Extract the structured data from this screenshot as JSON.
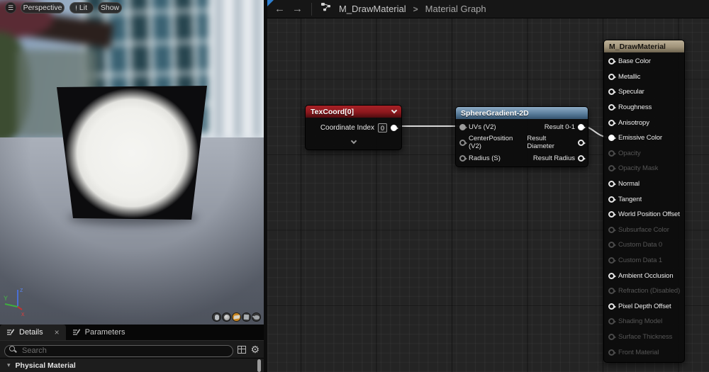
{
  "viewport_toolbar": {
    "menu_icon": "hamburger-menu",
    "perspective_label": "Perspective",
    "lit_label": "Lit",
    "show_label": "Show"
  },
  "viewport": {
    "axis_gizmo": {
      "x_label": "x",
      "y_label": "Y",
      "z_label": "z"
    },
    "preview_shapes": [
      "cylinder",
      "sphere",
      "plane",
      "cube",
      "teapot"
    ],
    "selected_shape": "plane"
  },
  "graph_header": {
    "back_icon": "←",
    "forward_icon": "→",
    "material_name": "M_DrawMaterial",
    "separator": ">",
    "graph_name": "Material Graph"
  },
  "nodes": {
    "texcoord": {
      "title": "TexCoord[0]",
      "row_label": "Coordinate Index",
      "row_value": "0"
    },
    "sphere_gradient": {
      "title": "SphereGradient-2D",
      "inputs": [
        {
          "label": "UVs (V2)",
          "connected": true
        },
        {
          "label": "CenterPosition (V2)",
          "connected": false
        },
        {
          "label": "Radius (S)",
          "connected": false
        }
      ],
      "outputs": [
        {
          "label": "Result 0-1",
          "connected": true
        },
        {
          "label": "Result Diameter",
          "connected": false
        },
        {
          "label": "Result Radius",
          "connected": false
        }
      ]
    },
    "result": {
      "title": "M_DrawMaterial",
      "pins": [
        {
          "label": "Base Color",
          "enabled": true,
          "connected": false
        },
        {
          "label": "Metallic",
          "enabled": true,
          "connected": false
        },
        {
          "label": "Specular",
          "enabled": true,
          "connected": false
        },
        {
          "label": "Roughness",
          "enabled": true,
          "connected": false
        },
        {
          "label": "Anisotropy",
          "enabled": true,
          "connected": false
        },
        {
          "label": "Emissive Color",
          "enabled": true,
          "connected": true
        },
        {
          "label": "Opacity",
          "enabled": false,
          "connected": false
        },
        {
          "label": "Opacity Mask",
          "enabled": false,
          "connected": false
        },
        {
          "label": "Normal",
          "enabled": true,
          "connected": false
        },
        {
          "label": "Tangent",
          "enabled": true,
          "connected": false
        },
        {
          "label": "World Position Offset",
          "enabled": true,
          "connected": false
        },
        {
          "label": "Subsurface Color",
          "enabled": false,
          "connected": false
        },
        {
          "label": "Custom Data 0",
          "enabled": false,
          "connected": false
        },
        {
          "label": "Custom Data 1",
          "enabled": false,
          "connected": false
        },
        {
          "label": "Ambient Occlusion",
          "enabled": true,
          "connected": false
        },
        {
          "label": "Refraction (Disabled)",
          "enabled": false,
          "connected": false
        },
        {
          "label": "Pixel Depth Offset",
          "enabled": true,
          "connected": false
        },
        {
          "label": "Shading Model",
          "enabled": false,
          "connected": false
        },
        {
          "label": "Surface Thickness",
          "enabled": false,
          "connected": false
        },
        {
          "label": "Front Material",
          "enabled": false,
          "connected": false
        }
      ]
    }
  },
  "details_panel": {
    "tabs": [
      {
        "label": "Details"
      },
      {
        "label": "Parameters"
      }
    ],
    "close_icon": "×",
    "search_placeholder": "Search",
    "section_header": "Physical Material",
    "expander_icon": "▾",
    "gear_icon": "⚙"
  },
  "colors": {
    "texcoord_header": "#8c181d",
    "sphere_gradient_header": "#5b7e9c",
    "result_header": "#a0937a",
    "selected_shape_highlight": "#c8851f",
    "wire": "#d8d8d8",
    "graph_background": "#242424"
  }
}
